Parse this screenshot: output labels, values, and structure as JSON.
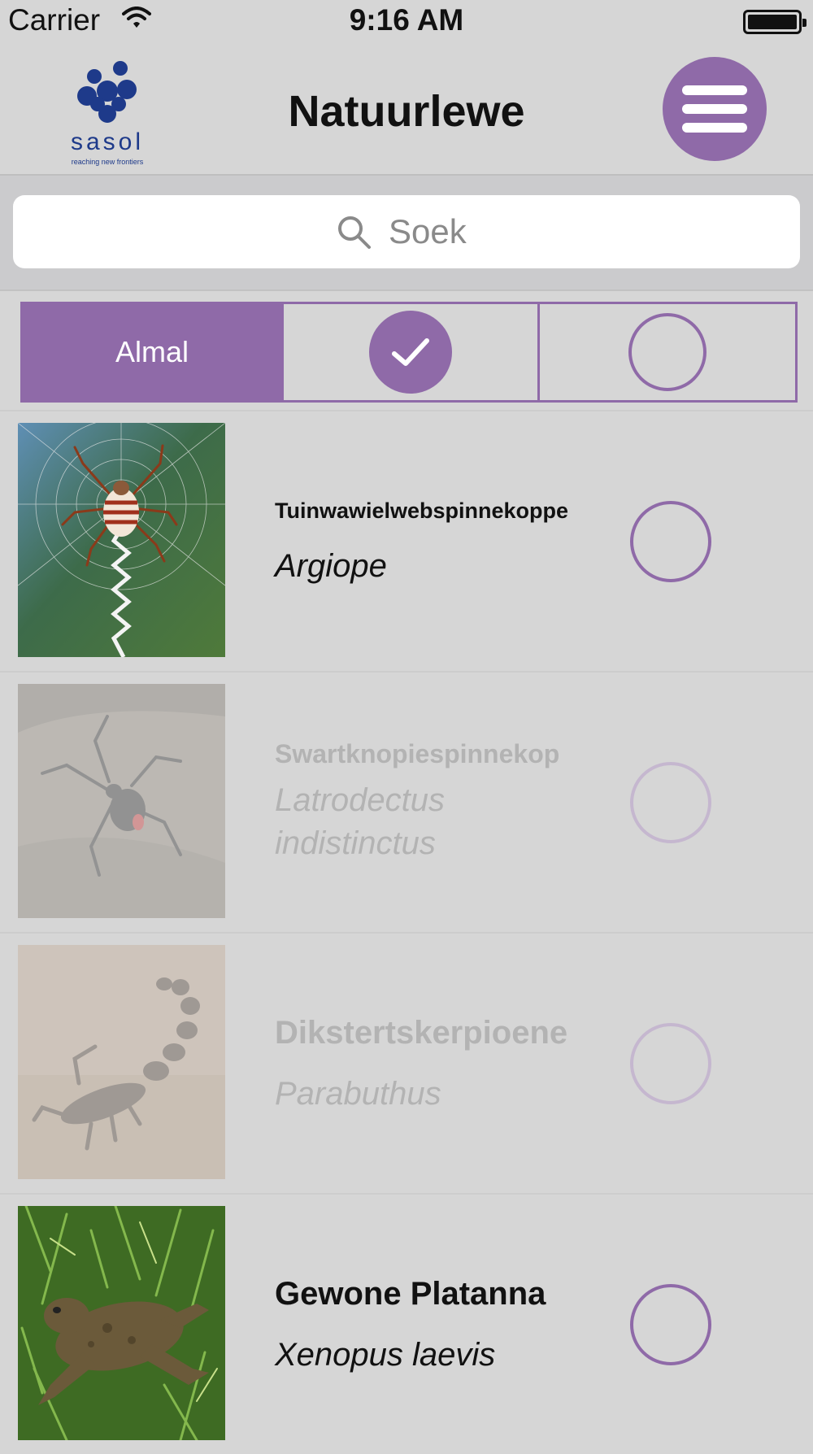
{
  "status_bar": {
    "carrier": "Carrier",
    "time": "9:16 AM"
  },
  "header": {
    "logo_text": "sasol",
    "logo_tagline": "reaching new frontiers",
    "title": "Natuurlewe",
    "menu_icon": "hamburger-menu-icon"
  },
  "search": {
    "placeholder": "Soek",
    "icon": "search-icon"
  },
  "filter": {
    "all_label": "Almal",
    "checked_icon": "check-icon",
    "unchecked_icon": "empty-circle-icon",
    "selected": "Almal"
  },
  "species": [
    {
      "common_name": "Tuinwawielwebspinnekoppe",
      "scientific_name": "Argiope",
      "faded": false,
      "image": "spider-on-web"
    },
    {
      "common_name": "Swartknopiespinnekop",
      "scientific_name": "Latrodectus indistinctus",
      "faded": true,
      "image": "black-widow-spider"
    },
    {
      "common_name": "Dikstertskerpioene",
      "scientific_name": "Parabuthus",
      "faded": true,
      "image": "scorpion"
    },
    {
      "common_name": "Gewone Platanna",
      "scientific_name": "Xenopus laevis",
      "faded": false,
      "image": "frog-in-grass"
    }
  ],
  "colors": {
    "accent": "#8f6aa8",
    "background": "#d6d6d6",
    "faded_text": "#b3b3b3"
  }
}
